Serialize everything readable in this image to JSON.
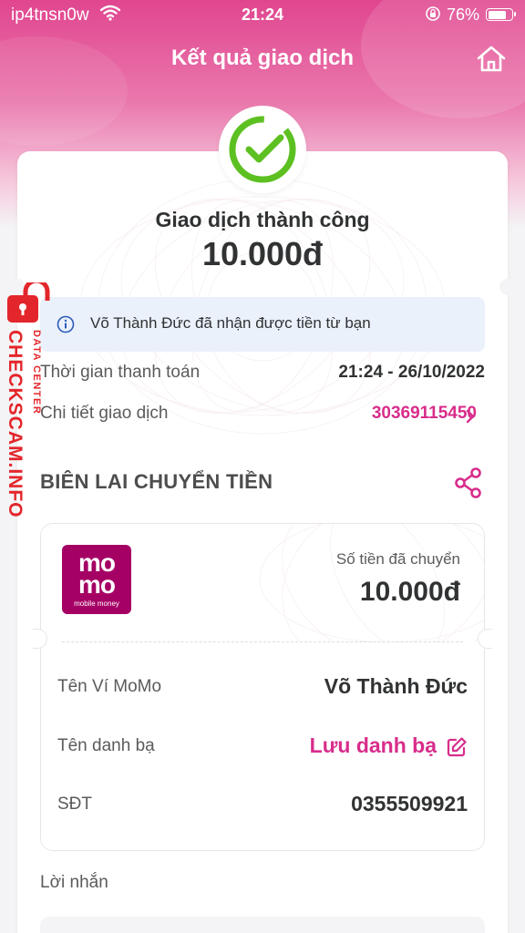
{
  "status_bar": {
    "carrier": "ip4tnsn0w",
    "time": "21:24",
    "battery": "76%",
    "battery_level": 0.76
  },
  "header": {
    "title": "Kết quả giao dịch",
    "home_icon": "home-icon"
  },
  "result": {
    "status_icon": "check-circle-icon",
    "title": "Giao dịch thành công",
    "amount": "10.000đ",
    "info_message": "Võ Thành Đức đã nhận được tiền từ bạn"
  },
  "details": {
    "time_label": "Thời gian thanh toán",
    "time_value": "21:24 - 26/10/2022",
    "txn_label": "Chi tiết giao dịch",
    "txn_value": "30369115450"
  },
  "receipt": {
    "section_title": "BIÊN LAI CHUYỂN TIỀN",
    "share_icon": "share-icon",
    "logo": {
      "line1": "mo",
      "line2": "mo",
      "tagline": "mobile money"
    },
    "sent_label": "Số tiền đã chuyển",
    "sent_amount": "10.000đ",
    "wallet_label": "Tên Ví MoMo",
    "wallet_value": "Võ Thành Đức",
    "contact_label": "Tên danh bạ",
    "contact_value": "Lưu danh bạ",
    "phone_label": "SĐT",
    "phone_value": "0355509921"
  },
  "message": {
    "label": "Lời nhắn"
  },
  "watermark": {
    "main": "CHECKSCAM.INFO",
    "sub": "DATA CENTER"
  },
  "colors": {
    "brand_pink": "#d82d8b",
    "momo": "#a50064",
    "success_green": "#5cc021",
    "info_bg": "#eaf1fb",
    "watermark_red": "#e3262b"
  }
}
